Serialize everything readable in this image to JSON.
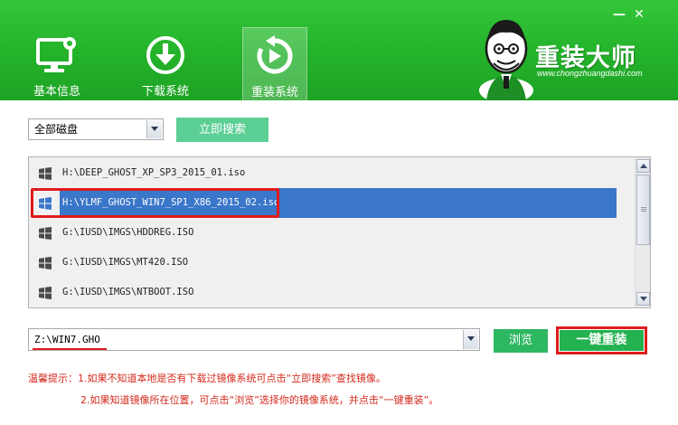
{
  "window": {
    "minimize_glyph": "—",
    "close_glyph": "✕"
  },
  "tabs": [
    {
      "label": "基本信息",
      "icon": "monitor-gear-icon"
    },
    {
      "label": "下载系统",
      "icon": "download-icon"
    },
    {
      "label": "重装系统",
      "icon": "reinstall-icon",
      "active": true
    }
  ],
  "brand": {
    "name": "重装大师",
    "url": "www.chongzhuangdashi.com",
    "mascot": "mascot-icon"
  },
  "disk_select": {
    "value": "全部磁盘"
  },
  "search_button": {
    "label": "立即搜索"
  },
  "image_list": [
    {
      "path": "H:\\DEEP_GHOST_XP_SP3_2015_01.iso"
    },
    {
      "path": "H:\\YLMF_GHOST_WIN7_SP1_X86_2015_02.iso",
      "selected": true
    },
    {
      "path": "G:\\IUSD\\IMGS\\HDDREG.ISO"
    },
    {
      "path": "G:\\IUSD\\IMGS\\MT420.ISO"
    },
    {
      "path": "G:\\IUSD\\IMGS\\NTBOOT.ISO"
    }
  ],
  "target_path": {
    "value": "Z:\\WIN7.GHO"
  },
  "browse_button": {
    "label": "浏览"
  },
  "reinstall_button": {
    "label": "一键重装"
  },
  "tips": {
    "line1": "温馨提示：1.如果不知道本地是否有下载过镜像系统可点击“立即搜索”查找镜像。",
    "line2": "2.如果知道镜像所在位置，可点击“浏览”选择你的镜像系统，并点击“一键重装”。"
  },
  "colors": {
    "header_green": "#23b22a",
    "selection_blue": "#3a76c9",
    "highlight_red": "#e01b1b",
    "tip_red": "#d42a1c",
    "button_green": "#24b14f",
    "search_button_green": "#5ccf95"
  }
}
